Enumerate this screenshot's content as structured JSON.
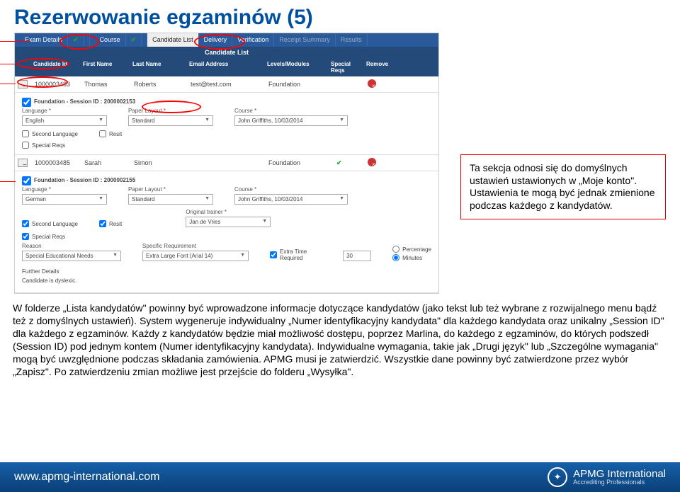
{
  "page_title": "Rezerwowanie egzaminów (5)",
  "tabs": {
    "exam_details": "Exam Details",
    "course": "Course",
    "candidate_list": "Candidate List",
    "delivery": "Delivery",
    "verification": "Verification",
    "receipt_summary": "Receipt Summary",
    "results": "Results"
  },
  "subheader": "Candidate List",
  "table": {
    "h_id": "Candidate Id",
    "h_fn": "First Name",
    "h_ln": "Last Name",
    "h_em": "Email Address",
    "h_lm": "Levels/Modules",
    "h_sr": "Special Reqs",
    "h_rm": "Remove",
    "r1": {
      "id": "1000003483",
      "fn": "Thomas",
      "ln": "Roberts",
      "em": "test@test.com",
      "lm": "Foundation"
    },
    "r2": {
      "id": "1000003485",
      "fn": "Sarah",
      "ln": "Simon",
      "em": "",
      "lm": "Foundation"
    }
  },
  "session1": {
    "label": "Foundation - Session ID : 2000002153",
    "lang_lbl": "Language *",
    "lang_val": "English",
    "paper_lbl": "Paper Layout *",
    "paper_val": "Standard",
    "course_lbl": "Course *",
    "course_val": "John Griffiths, 10/03/2014",
    "chk_sec": "Second Language",
    "chk_resit": "Resit",
    "sr_lbl": "Special Reqs"
  },
  "session2": {
    "label": "Foundation - Session ID : 2000002155",
    "lang_lbl": "Language *",
    "lang_val": "German",
    "paper_lbl": "Paper Layout *",
    "paper_val": "Standard",
    "course_lbl": "Course *",
    "course_val": "John Griffiths, 10/03/2014",
    "orig_lbl": "Original trainer *",
    "orig_val": "Jan de Vries",
    "chk_sec": "Second Language",
    "chk_resit": "Resit",
    "sr_lbl": "Special Reqs",
    "reason_lbl": "Reason",
    "reason_val": "Special Educational Needs",
    "spec_req_lbl": "Specific Requirement",
    "spec_req_val": "Extra Large Font (Arial 14)",
    "extra_time": "Extra Time Required",
    "extra_min": "30",
    "pct": "Percentage",
    "min": "Minutes",
    "fd_lbl": "Further Details",
    "fd_val": "Candidate is dyslexic."
  },
  "info_box": "Ta sekcja odnosi się do domyślnych ustawień ustawionych w „Moje konto\". Ustawienia te mogą być jednak zmienione podczas każdego z kandydatów.",
  "paragraph": "W folderze „Lista kandydatów\" powinny być wprowadzone informacje dotyczące kandydatów (jako tekst lub też wybrane z rozwijalnego menu bądź też z domyślnych ustawień). System wygeneruje indywidualny „Numer identyfikacyjny kandydata\" dla każdego kandydata oraz unikalny „Session ID\" dla każdego z egzaminów. Każdy z kandydatów będzie miał możliwość dostępu, poprzez Marlina, do każdego z egzaminów, do których podszedł (Session ID) pod jednym kontem (Numer identyfikacyjny kandydata). Indywidualne wymagania, takie jak „Drugi język\" lub „Szczególne wymagania\" mogą być uwzględnione podczas składania zamówienia. APMG musi je zatwierdzić. Wszystkie dane powinny być zatwierdzone przez wybór „Zapisz\". Po zatwierdzeniu zmian możliwe jest przejście do folderu „Wysyłka\".",
  "footer_url": "www.apmg-international.com",
  "footer_brand": "APMG International",
  "footer_tag": "Accrediting Professionals"
}
